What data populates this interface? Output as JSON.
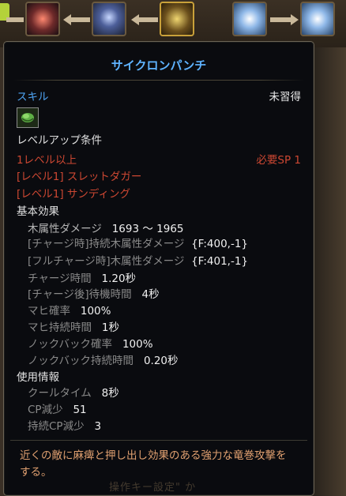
{
  "tooltip": {
    "title": "サイクロンパンチ",
    "type": "スキル",
    "status": "未習得",
    "levelup_header": "レベルアップ条件",
    "level_req": "1レベル以上",
    "sp_req": "必要SP 1",
    "prereq_1": "[レベル1] スレットダガー",
    "prereq_2": "[レベル1] サンディング",
    "basic_header": "基本効果",
    "basic": [
      {
        "label": "木属性ダメージ",
        "value": "1693 ～ 1965"
      },
      {
        "label": "[チャージ時]持続木属性ダメージ",
        "value": "{F:400,-1}"
      },
      {
        "label": "[フルチャージ時]木属性ダメージ",
        "value": "{F:401,-1}"
      },
      {
        "label": "チャージ時間",
        "value": "1.20秒"
      },
      {
        "label": "[チャージ後]待機時間",
        "value": "4秒"
      },
      {
        "label": "マヒ確率",
        "value": "100%"
      },
      {
        "label": "マヒ持続時間",
        "value": "1秒"
      },
      {
        "label": "ノックバック確率",
        "value": "100%"
      },
      {
        "label": "ノックバック持続時間",
        "value": "0.20秒"
      }
    ],
    "usage_header": "使用情報",
    "usage": [
      {
        "label": "クールタイム",
        "value": "8秒"
      },
      {
        "label": "CP減少",
        "value": "51"
      },
      {
        "label": "持続CP減少",
        "value": "3"
      }
    ],
    "description": "近くの敵に麻痺と押し出し効果のある強力な竜巻攻撃をする。"
  },
  "background": {
    "overlay_text": "操作キー設定\" か"
  },
  "colors": {
    "title": "#5fb3ff",
    "requirement_unmet": "#cc4732",
    "description": "#e0a070",
    "status": "#e8e8e8"
  }
}
